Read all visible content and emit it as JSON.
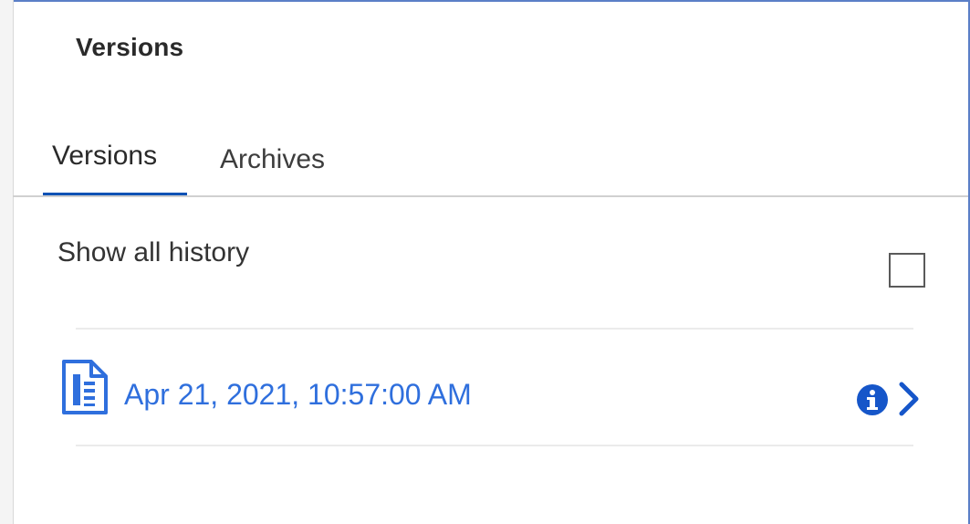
{
  "panel": {
    "title": "Versions"
  },
  "tabs": [
    {
      "label": "Versions",
      "selected": true
    },
    {
      "label": "Archives",
      "selected": false
    }
  ],
  "history": {
    "label": "Show all history",
    "checked": false
  },
  "versions": [
    {
      "icon": "document-icon",
      "date": "Apr 21, 2021, 10:57:00 AM"
    }
  ],
  "colors": {
    "accent": "#0f52b5",
    "link": "#2f6fdd",
    "frame": "#5b7fc7"
  }
}
